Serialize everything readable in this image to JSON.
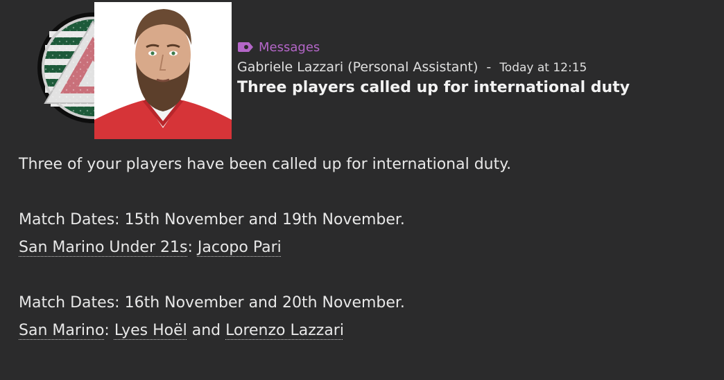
{
  "header": {
    "category": "Messages",
    "sender": "Gabriele Lazzari (Personal Assistant)",
    "separator": "-",
    "time": "Today at 12:15",
    "subject": "Three players called up for international duty"
  },
  "body": {
    "intro": "Three of your players have been called up for international duty.",
    "groups": [
      {
        "dates": "Match Dates: 15th November and 19th November.",
        "team": "San Marino Under 21s",
        "colon": ":",
        "players": [
          "Jacopo Pari"
        ],
        "conjunction": ""
      },
      {
        "dates": "Match Dates: 16th November and 20th November.",
        "team": "San Marino",
        "colon": ":",
        "players": [
          "Lyes Hoël",
          "Lorenzo Lazzari"
        ],
        "conjunction": "and"
      }
    ]
  },
  "colors": {
    "background": "#2b2b2c",
    "accent": "#b466c8",
    "text": "#e8e8e8"
  },
  "icons": {
    "category": "message-tag-icon",
    "club": "club-crest-icon",
    "avatar": "assistant-portrait"
  }
}
